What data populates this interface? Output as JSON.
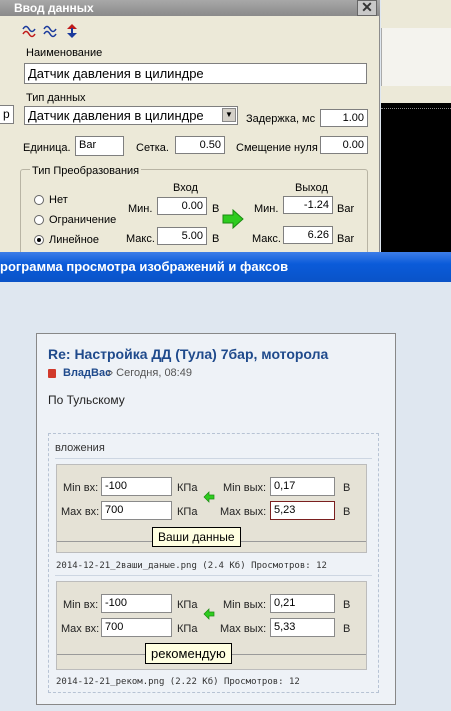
{
  "dialog": {
    "title": "Ввод данных",
    "close": "✕",
    "name_label": "Наименование",
    "name_value": "Датчик давления в цилиндре",
    "type_label": "Тип данных",
    "type_value": "Датчик давления в цилиндре",
    "delay_label": "Задержка, мс",
    "delay_value": "1.00",
    "unit_label": "Единица.",
    "unit_value": "Bar",
    "grid_label": "Сетка.",
    "grid_value": "0.50",
    "offset_label": "Смещение нуля",
    "offset_value": "0.00",
    "transform_label": "Тип Преобразования",
    "radio_none": "Нет",
    "radio_limit": "Ограничение",
    "radio_linear": "Линейное",
    "input_label": "Вход",
    "output_label": "Выход",
    "min_label": "Мин.",
    "max_label": "Макс.",
    "in_min": "0.00",
    "in_max": "5.00",
    "in_unit": "В",
    "out_min": "-1.24",
    "out_max": "6.26",
    "out_unit": "Bar",
    "left_stub": "р"
  },
  "viewer": {
    "title": "рограмма просмотра изображений и факсов"
  },
  "post": {
    "title": "Re: Настройка ДД (Тула) 7бар, моторола",
    "author": "ВладВас",
    "time": "» Сегодня, 08:49",
    "text": "По Тульскому",
    "attachments_label": "вложения",
    "att1": {
      "min_in_label": "Min вх:",
      "min_in": "-100",
      "kpa1": "КПа",
      "max_in_label": "Max вх:",
      "max_in": "700",
      "kpa2": "КПа",
      "min_out_label": "Min вых:",
      "min_out": "0,17",
      "v1": "В",
      "max_out_label": "Max вых:",
      "max_out": "5,23",
      "v2": "В",
      "callout": "Ваши данные",
      "caption": "2014-12-21_2ваши_даные.png (2.4 Кб) Просмотров: 12"
    },
    "att2": {
      "min_in_label": "Min вх:",
      "min_in": "-100",
      "kpa1": "КПа",
      "max_in_label": "Max вх:",
      "max_in": "700",
      "kpa2": "КПа",
      "min_out_label": "Min вых:",
      "min_out": "0,21",
      "v1": "В",
      "max_out_label": "Max вых:",
      "max_out": "5,33",
      "v2": "В",
      "callout": "рекомендую",
      "caption": "2014-12-21_реком.png (2.22 Кб) Просмотров: 12"
    }
  },
  "colors": {
    "viewer_bar": "#0b5bd9",
    "post_title": "#1f4a8c",
    "arrow_green": "#2ecc1f"
  }
}
